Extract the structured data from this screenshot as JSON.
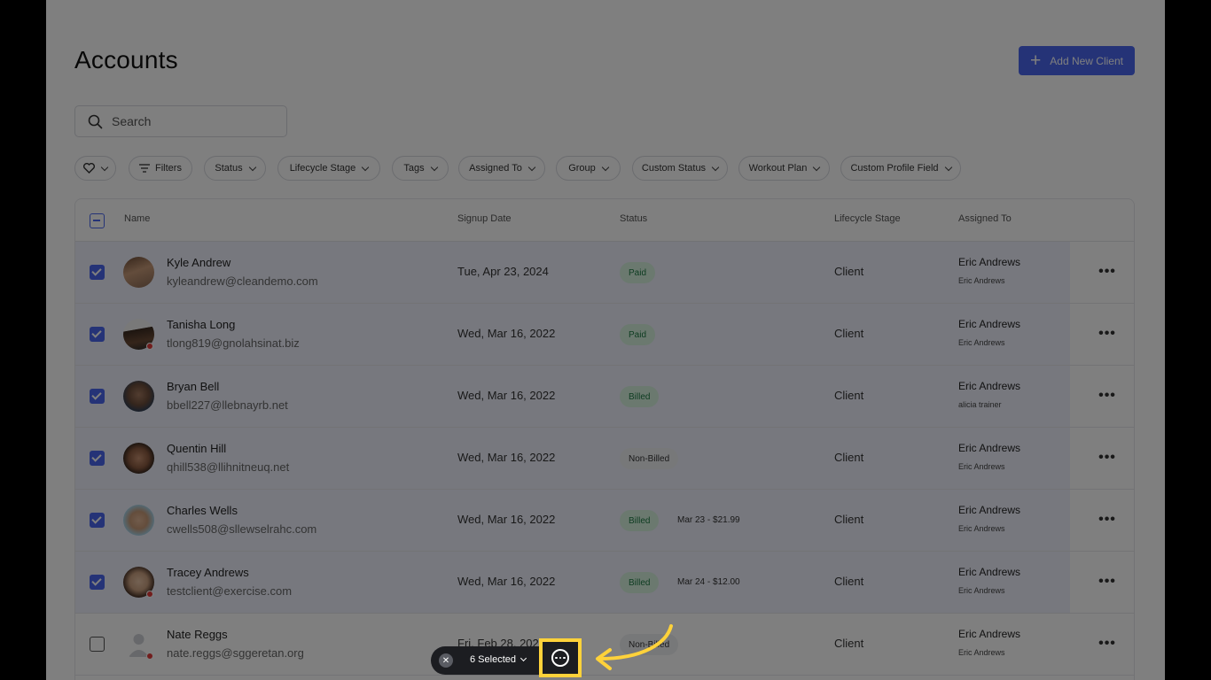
{
  "page": {
    "title": "Accounts",
    "add_button_label": "Add New Client",
    "search_placeholder": "Search"
  },
  "filters": {
    "favorites_icon": "heart-icon",
    "items": [
      "Filters",
      "Status",
      "Lifecycle Stage",
      "Tags",
      "Assigned To",
      "Group",
      "Custom Status",
      "Workout Plan",
      "Custom Profile Field"
    ]
  },
  "table": {
    "columns": {
      "name": "Name",
      "signup_date": "Signup Date",
      "status": "Status",
      "lifecycle_stage": "Lifecycle Stage",
      "assigned_to": "Assigned To"
    },
    "rows": [
      {
        "selected": true,
        "name": "Kyle Andrew",
        "email": "kyleandrew@cleandemo.com",
        "signup_date": "Tue, Apr 23, 2024",
        "status": "Paid",
        "status_note": "",
        "stage": "Client",
        "assigned": "Eric Andrews",
        "assigned_sub": "Eric Andrews",
        "online_dot": false
      },
      {
        "selected": true,
        "name": "Tanisha Long",
        "email": "tlong819@gnolahsinat.biz",
        "signup_date": "Wed, Mar 16, 2022",
        "status": "Paid",
        "status_note": "",
        "stage": "Client",
        "assigned": "Eric Andrews",
        "assigned_sub": "Eric Andrews",
        "online_dot": true
      },
      {
        "selected": true,
        "name": "Bryan Bell",
        "email": "bbell227@llebnayrb.net",
        "signup_date": "Wed, Mar 16, 2022",
        "status": "Billed",
        "status_note": "",
        "stage": "Client",
        "assigned": "Eric Andrews",
        "assigned_sub": "alicia trainer",
        "online_dot": false
      },
      {
        "selected": true,
        "name": "Quentin Hill",
        "email": "qhill538@llihnitneuq.net",
        "signup_date": "Wed, Mar 16, 2022",
        "status": "Non-Billed",
        "status_note": "",
        "stage": "Client",
        "assigned": "Eric Andrews",
        "assigned_sub": "Eric Andrews",
        "online_dot": false
      },
      {
        "selected": true,
        "name": "Charles Wells",
        "email": "cwells508@sllewselrahc.com",
        "signup_date": "Wed, Mar 16, 2022",
        "status": "Billed",
        "status_note": "Mar 23 - $21.99",
        "stage": "Client",
        "assigned": "Eric Andrews",
        "assigned_sub": "Eric Andrews",
        "online_dot": false
      },
      {
        "selected": true,
        "name": "Tracey Andrews",
        "email": "testclient@exercise.com",
        "signup_date": "Wed, Mar 16, 2022",
        "status": "Billed",
        "status_note": "Mar 24 - $12.00",
        "stage": "Client",
        "assigned": "Eric Andrews",
        "assigned_sub": "Eric Andrews",
        "online_dot": true
      },
      {
        "selected": false,
        "name": "Nate Reggs",
        "email": "nate.reggs@sggeretan.org",
        "signup_date": "Fri, Feb 28, 2025",
        "status": "Non-Billed",
        "status_note": "",
        "stage": "Client",
        "assigned": "Eric Andrews",
        "assigned_sub": "Eric Andrews",
        "online_dot": true
      }
    ]
  },
  "bulk_bar": {
    "selected_label": "6 Selected",
    "close_icon": "close-icon",
    "actions_icon": "more-horizontal-circle-icon"
  },
  "colors": {
    "accent": "#4a66ef",
    "paid_badge_bg": "#d7f2df",
    "paid_badge_text": "#1d7a43",
    "highlight": "#ffd23a",
    "overlay": "rgba(0,0,0,0.5)"
  }
}
